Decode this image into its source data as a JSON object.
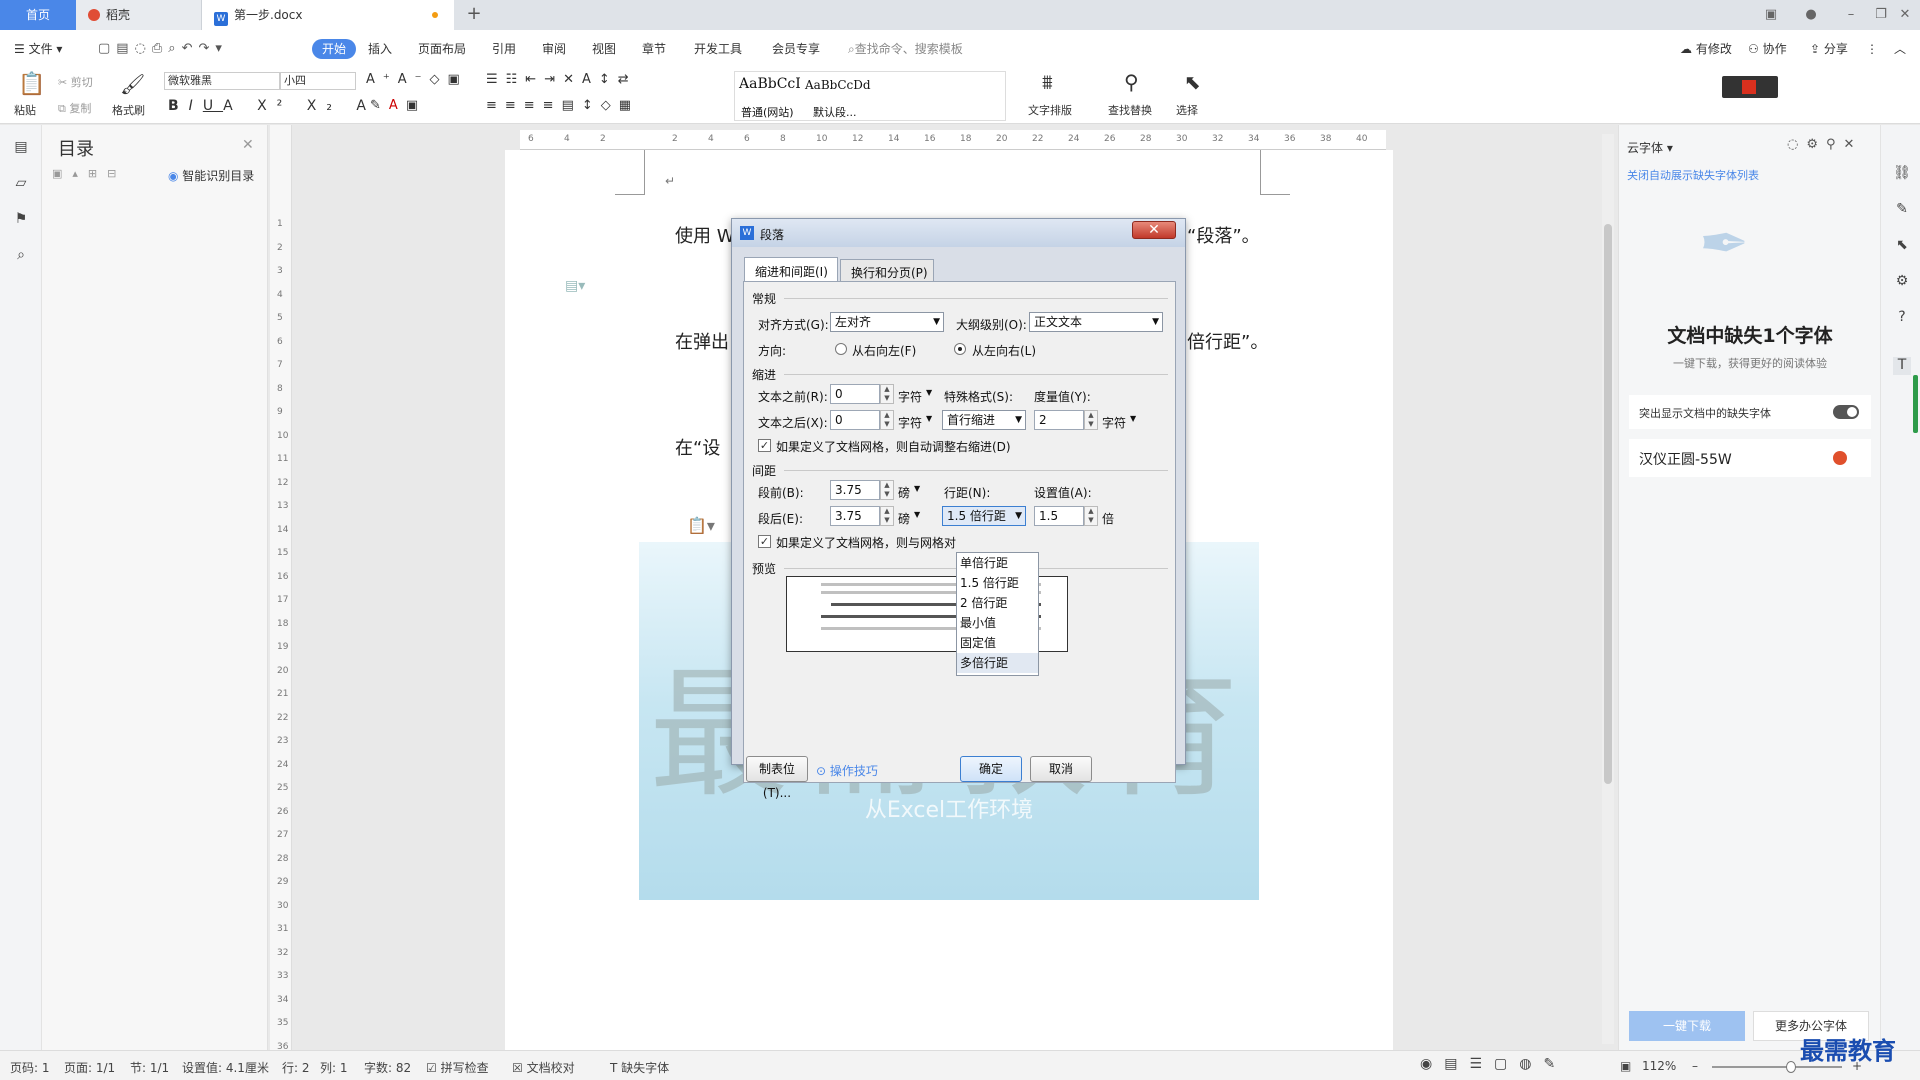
{
  "tabs": {
    "home": "首页",
    "daoke": "稻壳",
    "doc": "第一步.docx",
    "add": "+"
  },
  "menu": {
    "file": "文件",
    "start": "开始",
    "insert": "插入",
    "layout": "页面布局",
    "ref": "引用",
    "review": "审阅",
    "view": "视图",
    "chapter": "章节",
    "dev": "开发工具",
    "member": "会员专享",
    "search": "查找命令、搜索模板",
    "modified": "有修改",
    "collab": "协作",
    "share": "分享"
  },
  "ribbon": {
    "paste": "粘贴",
    "cut": "剪切",
    "copy": "复制",
    "format_brush": "格式刷",
    "font_name": "微软雅黑",
    "font_size": "小四",
    "style1_sample": "AaBbCcI",
    "style2_sample": "AaBbCcDd",
    "style1_name": "普通(网站)",
    "style2_name": "默认段...",
    "text_layout": "文字排版",
    "find_replace": "查找替换",
    "select": "选择"
  },
  "toc": {
    "title": "目录",
    "smart": "智能识别目录"
  },
  "document": {
    "p1_start": "使用 W",
    "p1_end": "“段落”。",
    "p2_start": "在弹出",
    "p2_end": "倍行距”。",
    "p3_start": "在“设",
    "banner_big": "最需教育",
    "banner_sub": "从Excel工作环境",
    "para_mark": "↵"
  },
  "dialog": {
    "title": "段落",
    "tab1": "缩进和间距(I)",
    "tab2": "换行和分页(P)",
    "sec_general": "常规",
    "align_label": "对齐方式(G):",
    "align_value": "左对齐",
    "outline_label": "大纲级别(O):",
    "outline_value": "正文文本",
    "direction_label": "方向:",
    "rtl": "从右向左(F)",
    "ltr": "从左向右(L)",
    "sec_indent": "缩进",
    "before_text_label": "文本之前(R):",
    "before_text_value": "0",
    "after_text_label": "文本之后(X):",
    "after_text_value": "0",
    "unit_char": "字符",
    "special_label": "特殊格式(S):",
    "special_value": "首行缩进",
    "measure_label": "度量值(Y):",
    "measure_value": "2",
    "grid_indent": "如果定义了文档网格，则自动调整右缩进(D)",
    "sec_spacing": "间距",
    "before_label": "段前(B):",
    "before_value": "3.75",
    "after_label": "段后(E):",
    "after_value": "3.75",
    "unit_pt": "磅",
    "line_label": "行距(N):",
    "line_value": "1.5 倍行距",
    "setting_label": "设置值(A):",
    "setting_value": "1.5",
    "unit_times": "倍",
    "grid_align": "如果定义了文档网格，则与网格对",
    "sec_preview": "预览",
    "tabs_button": "制表位(T)...",
    "tips": "操作技巧",
    "ok": "确定",
    "cancel": "取消",
    "line_options": [
      "单倍行距",
      "1.5 倍行距",
      "2 倍行距",
      "最小值",
      "固定值",
      "多倍行距"
    ]
  },
  "right_panel": {
    "title": "云字体",
    "close_list": "关闭自动展示缺失字体列表",
    "heading": "文档中缺失1个字体",
    "sub": "一键下载，获得更好的阅读体验",
    "highlight": "突出显示文档中的缺失字体",
    "font": "汉仪正圆-55W",
    "download": "一键下载",
    "more": "更多办公字体"
  },
  "status": {
    "page_code": "页码: 1",
    "page": "页面: 1/1",
    "section": "节: 1/1",
    "setting": "设置值: 4.1厘米",
    "row": "行: 2",
    "col": "列: 1",
    "words": "字数: 82",
    "spell": "拼写检查",
    "proof": "文档校对",
    "missing": "缺失字体",
    "zoom": "112%",
    "watermark": "最需教育"
  },
  "ruler_h": [
    "6",
    "4",
    "2",
    "",
    "2",
    "4",
    "6",
    "8",
    "10",
    "12",
    "14",
    "16",
    "18",
    "20",
    "22",
    "24",
    "26",
    "28",
    "30",
    "32",
    "34",
    "36",
    "38",
    "40"
  ],
  "ruler_v": [
    "1",
    "2",
    "3",
    "4",
    "5",
    "6",
    "7",
    "8",
    "9",
    "10",
    "11",
    "12",
    "13",
    "14",
    "15",
    "16",
    "17",
    "18",
    "19",
    "20",
    "21",
    "22",
    "23",
    "24",
    "25",
    "26",
    "27",
    "28",
    "29",
    "30",
    "31",
    "32",
    "33",
    "34",
    "35",
    "36"
  ]
}
